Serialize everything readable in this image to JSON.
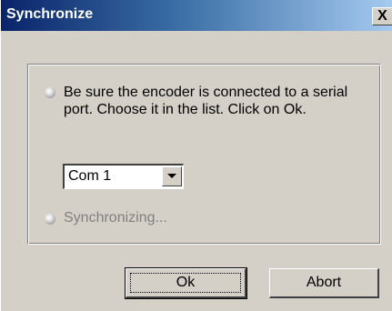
{
  "window": {
    "title": "Synchronize",
    "close_label": "X"
  },
  "content": {
    "instruction": "Be sure the encoder is connected to a serial port. Choose it in the list. Click on Ok.",
    "status": "Synchronizing...",
    "port_select": {
      "value": "Com 1"
    }
  },
  "buttons": {
    "ok_label": "Ok",
    "abort_label": "Abort"
  },
  "colors": {
    "titlebar_start": "#0a246a",
    "titlebar_end": "#a6caf0",
    "face": "#d4d0c8",
    "disabled_text": "#808080"
  }
}
